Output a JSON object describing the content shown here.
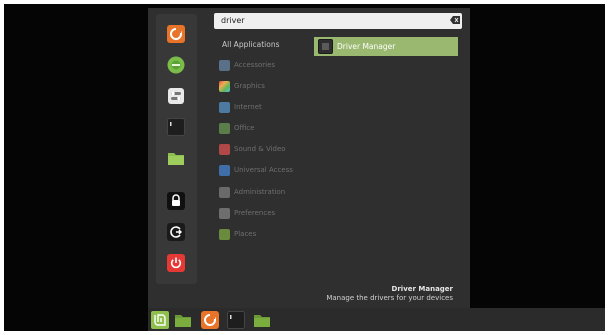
{
  "search": {
    "value": "driver",
    "clear_icon": "backspace-clear-icon"
  },
  "categories": {
    "all_label": "All Applications",
    "items": [
      {
        "label": "Accessories",
        "icon": "accessories-icon",
        "color": "#5a6f88"
      },
      {
        "label": "Graphics",
        "icon": "graphics-icon",
        "color": "#b3566d"
      },
      {
        "label": "Internet",
        "icon": "internet-icon",
        "color": "#4c7aa0"
      },
      {
        "label": "Office",
        "icon": "office-icon",
        "color": "#5b7d4a"
      },
      {
        "label": "Sound & Video",
        "icon": "sound-video-icon",
        "color": "#b04848"
      },
      {
        "label": "Universal Access",
        "icon": "universal-access-icon",
        "color": "#3f6ea8"
      },
      {
        "label": "Administration",
        "icon": "administration-icon",
        "color": "#6a6a6a"
      },
      {
        "label": "Preferences",
        "icon": "preferences-icon",
        "color": "#6e6e6e"
      },
      {
        "label": "Places",
        "icon": "places-folder-icon",
        "color": "#6a8a3e"
      }
    ]
  },
  "results": [
    {
      "label": "Driver Manager",
      "icon": "driver-manager-icon"
    }
  ],
  "description": {
    "title": "Driver Manager",
    "text": "Manage the drivers for your devices"
  },
  "favorites": [
    {
      "name": "firefox-icon",
      "color": "#e8742a"
    },
    {
      "name": "software-manager-icon",
      "color": "#7bbd4a"
    },
    {
      "name": "system-settings-icon",
      "color": "#e8e8e8"
    },
    {
      "name": "terminal-icon",
      "color": "#1e1e1e"
    },
    {
      "name": "files-folder-icon",
      "color": "#8bbf4f"
    },
    {
      "name": "lock-screen-icon",
      "color": "#101010"
    },
    {
      "name": "logout-icon",
      "color": "#1a1a1a"
    },
    {
      "name": "shutdown-icon",
      "color": "#e53935"
    }
  ],
  "panel": [
    {
      "name": "mint-menu-icon",
      "color": "#8fbf4f"
    },
    {
      "name": "show-desktop-folder-icon",
      "color": "#7aad3e"
    },
    {
      "name": "firefox-icon",
      "color": "#e8742a"
    },
    {
      "name": "terminal-icon",
      "color": "#1e1e1e"
    },
    {
      "name": "files-folder-icon",
      "color": "#7aad3e"
    }
  ]
}
